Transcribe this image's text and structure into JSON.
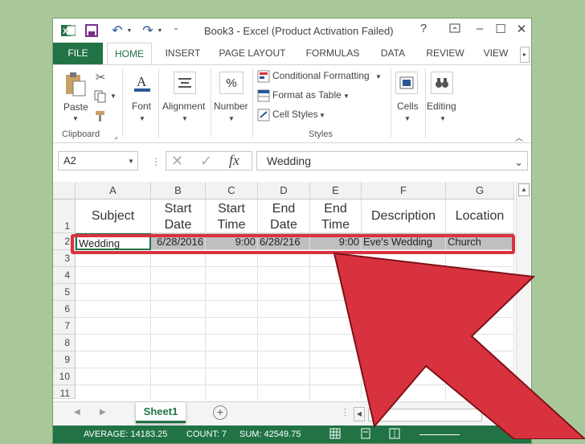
{
  "window": {
    "title": "Book3 - Excel (Product Activation Failed)",
    "controls": [
      "?",
      "–",
      "☐",
      "✕"
    ]
  },
  "tabs": [
    "FILE",
    "HOME",
    "INSERT",
    "PAGE LAYOUT",
    "FORMULAS",
    "DATA",
    "REVIEW",
    "VIEW"
  ],
  "ribbon": {
    "paste": "Paste",
    "font": "Font",
    "alignment": "Alignment",
    "number": "Number",
    "conditional_formatting": "Conditional Formatting",
    "format_as_table": "Format as Table",
    "cell_styles": "Cell Styles",
    "cells": "Cells",
    "editing": "Editing",
    "group_clipboard": "Clipboard",
    "group_styles": "Styles"
  },
  "formula_bar": {
    "name_box": "A2",
    "fx": "fx",
    "value": "Wedding"
  },
  "sheet": {
    "columns": [
      "A",
      "B",
      "C",
      "D",
      "E",
      "F",
      "G"
    ],
    "rows": [
      "1",
      "2",
      "3",
      "4",
      "5",
      "6",
      "7",
      "8",
      "9",
      "10",
      "11"
    ],
    "headers": [
      "Subject",
      "Start Date",
      "Start Time",
      "End Date",
      "End Time",
      "Description",
      "Location"
    ],
    "row2": [
      "Wedding",
      "6/28/2016",
      "9:00",
      "6/28/216",
      "9:00",
      "Eve's Wedding",
      "Church"
    ]
  },
  "sheet_tabs": {
    "active": "Sheet1",
    "add": "+"
  },
  "status_bar": {
    "average": "AVERAGE: 14183.25",
    "count": "COUNT: 7",
    "sum": "SUM: 42549.75",
    "zoom_plus": "+"
  },
  "colors": {
    "excel_green": "#217346",
    "annotation_red": "#d9323f",
    "selection_gray": "#bfbfbf"
  }
}
